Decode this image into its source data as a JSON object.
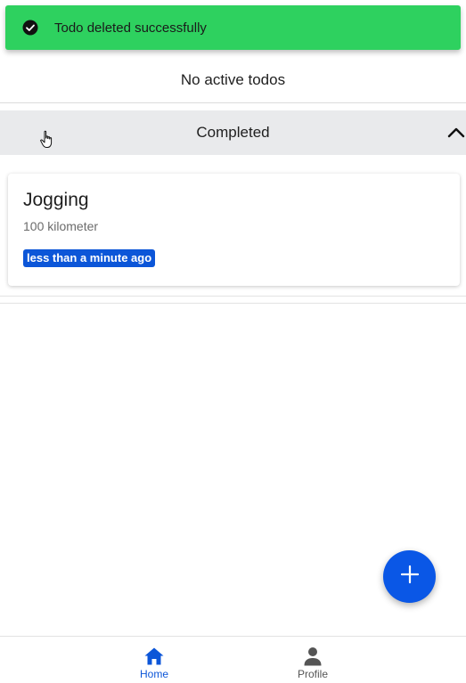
{
  "toast": {
    "message": "Todo deleted successfully",
    "icon": "check-circle-icon",
    "color": "#2ed15f"
  },
  "active": {
    "empty_text": "No active todos"
  },
  "completed": {
    "header_label": "Completed",
    "toggle_icon": "chevron-up-icon",
    "items": [
      {
        "title": "Jogging",
        "subtitle": "100 kilometer",
        "badge": "less than a minute ago"
      }
    ]
  },
  "fab": {
    "icon": "plus-icon",
    "color": "#0a57e6"
  },
  "bottom_nav": {
    "items": [
      {
        "label": "Home",
        "icon": "home-icon",
        "active": true
      },
      {
        "label": "Profile",
        "icon": "person-icon",
        "active": false
      }
    ],
    "accent": "#0c56d8"
  }
}
